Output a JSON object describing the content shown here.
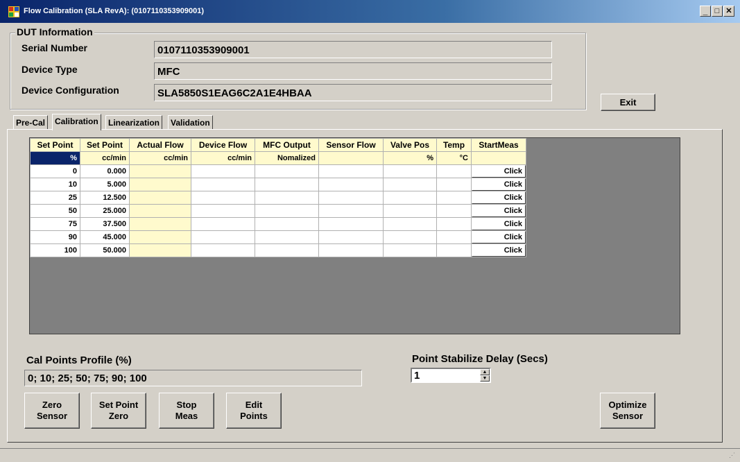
{
  "window": {
    "title": "Flow Calibration  (SLA RevA): (0107110353909001)",
    "minimize_glyph": "_",
    "maximize_glyph": "□",
    "close_glyph": "✕"
  },
  "dut": {
    "legend": "DUT Information",
    "serial_label": "Serial Number",
    "serial_value": "0107110353909001",
    "type_label": "Device Type",
    "type_value": "MFC",
    "config_label": "Device Configuration",
    "config_value": "SLA5850S1EAG6C2A1E4HBAA"
  },
  "exit_label": "Exit",
  "tabs": [
    {
      "label": "Pre-Cal"
    },
    {
      "label": "Calibration"
    },
    {
      "label": "Linearization"
    },
    {
      "label": "Validation"
    }
  ],
  "grid": {
    "headers": [
      "Set Point",
      "Set Point",
      "Actual Flow",
      "Device Flow",
      "MFC Output",
      "Sensor Flow",
      "Valve Pos",
      "Temp",
      "StartMeas"
    ],
    "units": [
      "%",
      "cc/min",
      "cc/min",
      "cc/min",
      "Nomalized",
      "",
      "%",
      "°C",
      ""
    ],
    "rows": [
      {
        "sp_pct": "0",
        "sp_ccm": "0.000",
        "btn": "Click"
      },
      {
        "sp_pct": "10",
        "sp_ccm": "5.000",
        "btn": "Click"
      },
      {
        "sp_pct": "25",
        "sp_ccm": "12.500",
        "btn": "Click"
      },
      {
        "sp_pct": "50",
        "sp_ccm": "25.000",
        "btn": "Click"
      },
      {
        "sp_pct": "75",
        "sp_ccm": "37.500",
        "btn": "Click"
      },
      {
        "sp_pct": "90",
        "sp_ccm": "45.000",
        "btn": "Click"
      },
      {
        "sp_pct": "100",
        "sp_ccm": "50.000",
        "btn": "Click"
      }
    ]
  },
  "cal_profile": {
    "label": "Cal Points Profile (%)",
    "value": "0; 10; 25; 50; 75; 90; 100"
  },
  "stabilize": {
    "label": "Point Stabilize Delay (Secs)",
    "value": "1"
  },
  "buttons": {
    "zero_sensor": [
      "Zero",
      "Sensor"
    ],
    "set_point_zero": [
      "Set Point",
      "Zero"
    ],
    "stop_meas": [
      "Stop",
      "Meas"
    ],
    "edit_points": [
      "Edit",
      "Points"
    ],
    "optimize_sensor": [
      "Optimize",
      "Sensor"
    ]
  },
  "colors": {
    "titlebar": "#0a246a",
    "grid_header": "#fffacd",
    "grid_background": "#808080",
    "selected_cell": "#0a246a"
  },
  "icons": [
    "app-icon",
    "resize-grip-icon",
    "spin-up-icon",
    "spin-down-icon"
  ]
}
